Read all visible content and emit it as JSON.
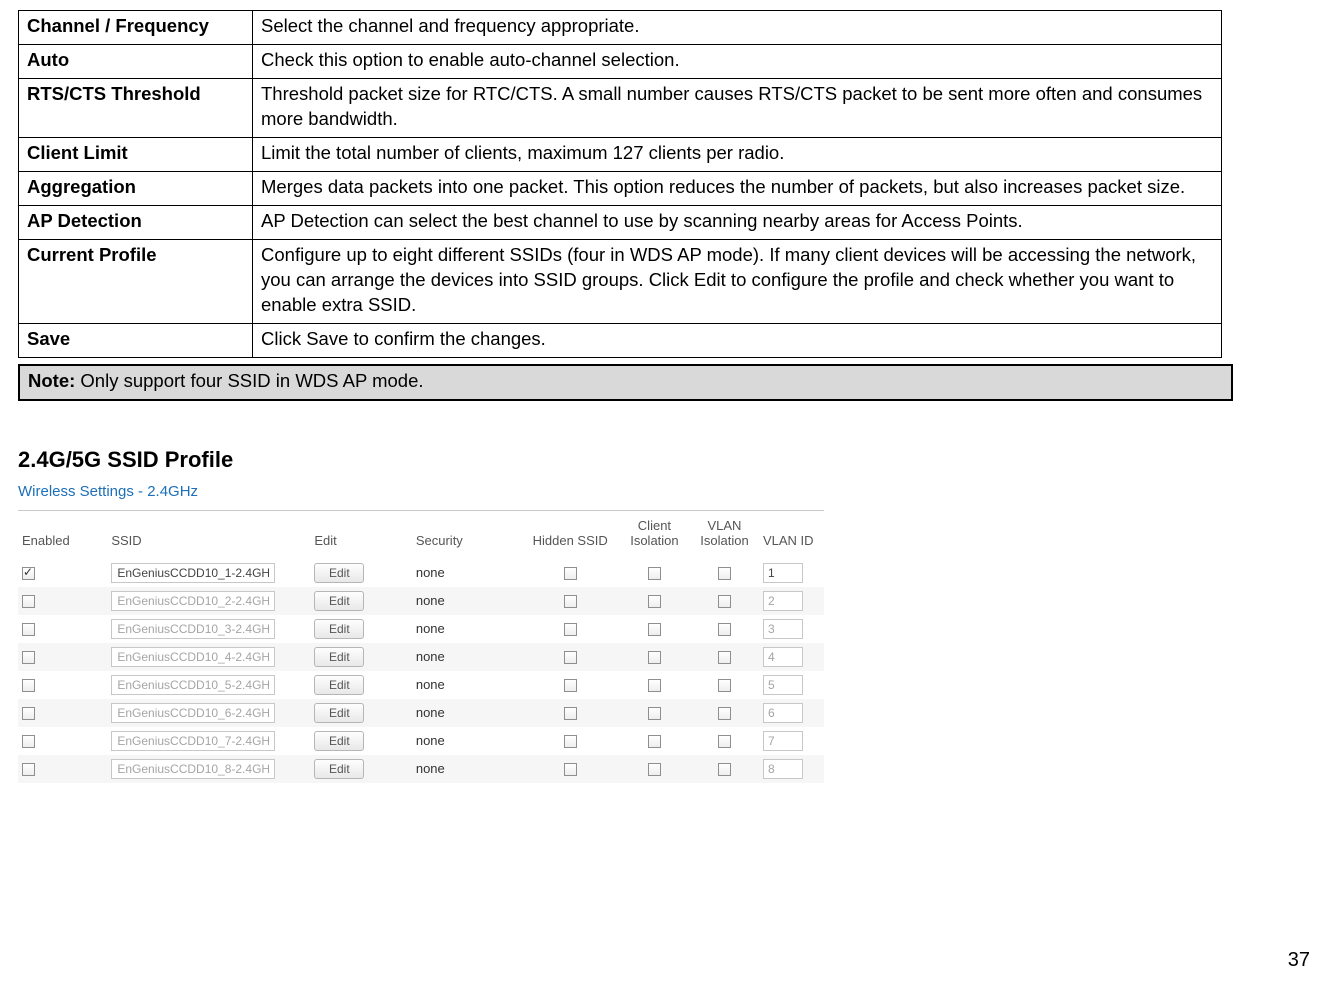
{
  "params": [
    {
      "key": "Channel / Frequency",
      "val": "Select the channel and frequency appropriate."
    },
    {
      "key": "Auto",
      "val": "Check this option to enable auto-channel selection."
    },
    {
      "key": "RTS/CTS Threshold",
      "val": "Threshold packet size for RTC/CTS. A small number causes RTS/CTS packet to be sent more often and consumes more bandwidth."
    },
    {
      "key": "Client Limit",
      "val": "Limit the total number of clients, maximum 127 clients per radio."
    },
    {
      "key": "Aggregation",
      "val": "Merges data packets into one packet. This option reduces the number of packets, but also increases packet size."
    },
    {
      "key": "AP Detection",
      "val": "AP Detection can select the best channel to use by scanning nearby areas for Access Points."
    },
    {
      "key": "Current Profile",
      "val": "Configure up to eight different SSIDs (four in WDS AP mode). If many client devices will be accessing the network, you can arrange the devices into SSID groups. Click Edit to configure the profile and check whether you want to enable extra SSID."
    },
    {
      "key": "Save",
      "val": "Click Save to confirm the changes."
    }
  ],
  "note": {
    "bold": "Note:",
    "text": " Only support four SSID in WDS AP mode."
  },
  "section_heading": "2.4G/5G SSID Profile",
  "ssid": {
    "title": "Wireless Settings - 2.4GHz",
    "headers": {
      "enabled": "Enabled",
      "ssid": "SSID",
      "edit": "Edit",
      "security": "Security",
      "hidden": "Hidden SSID",
      "client_iso": "Client Isolation",
      "vlan_iso": "VLAN Isolation",
      "vlan_id": "VLAN ID"
    },
    "edit_label": "Edit",
    "rows": [
      {
        "enabled": true,
        "ssid": "EnGeniusCCDD10_1-2.4GH",
        "security": "none",
        "hidden": false,
        "ci": false,
        "vi": false,
        "vid": "1"
      },
      {
        "enabled": false,
        "ssid": "EnGeniusCCDD10_2-2.4GH",
        "security": "none",
        "hidden": false,
        "ci": false,
        "vi": false,
        "vid": "2"
      },
      {
        "enabled": false,
        "ssid": "EnGeniusCCDD10_3-2.4GH",
        "security": "none",
        "hidden": false,
        "ci": false,
        "vi": false,
        "vid": "3"
      },
      {
        "enabled": false,
        "ssid": "EnGeniusCCDD10_4-2.4GH",
        "security": "none",
        "hidden": false,
        "ci": false,
        "vi": false,
        "vid": "4"
      },
      {
        "enabled": false,
        "ssid": "EnGeniusCCDD10_5-2.4GH",
        "security": "none",
        "hidden": false,
        "ci": false,
        "vi": false,
        "vid": "5"
      },
      {
        "enabled": false,
        "ssid": "EnGeniusCCDD10_6-2.4GH",
        "security": "none",
        "hidden": false,
        "ci": false,
        "vi": false,
        "vid": "6"
      },
      {
        "enabled": false,
        "ssid": "EnGeniusCCDD10_7-2.4GH",
        "security": "none",
        "hidden": false,
        "ci": false,
        "vi": false,
        "vid": "7"
      },
      {
        "enabled": false,
        "ssid": "EnGeniusCCDD10_8-2.4GH",
        "security": "none",
        "hidden": false,
        "ci": false,
        "vi": false,
        "vid": "8"
      }
    ]
  },
  "page_number": "37"
}
